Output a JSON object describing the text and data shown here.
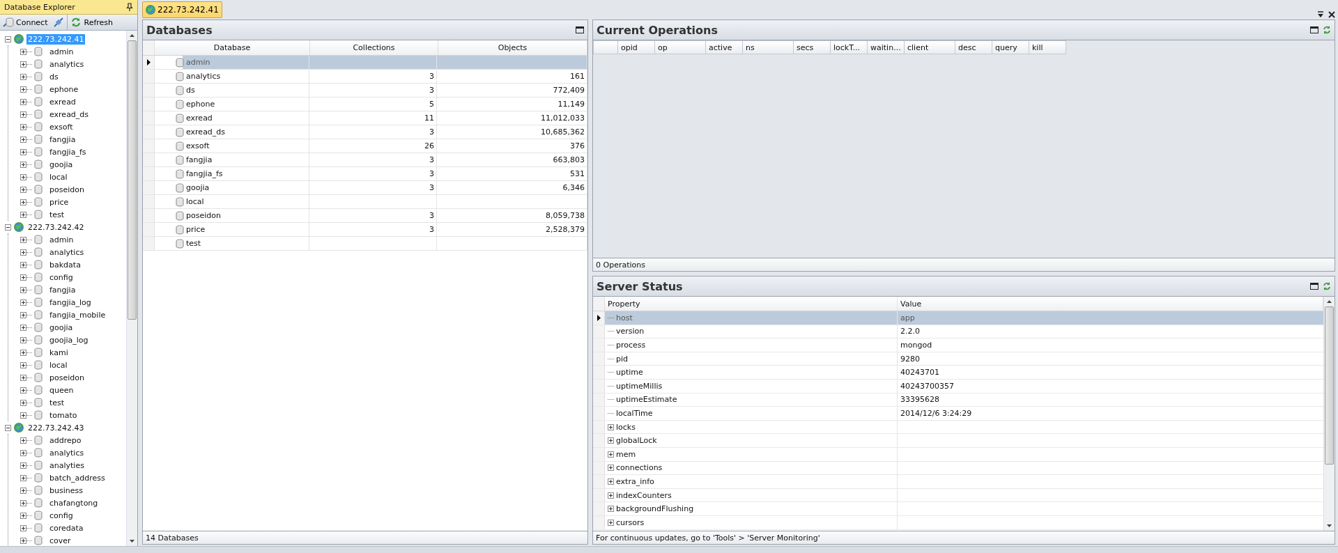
{
  "sidebar": {
    "title": "Database Explorer",
    "toolbar": [
      {
        "kind": "connect",
        "label": "Connect"
      },
      {
        "kind": "disconnect"
      },
      {
        "kind": "refresh",
        "label": "Refresh"
      }
    ],
    "tree": [
      {
        "label": "222.73.242.41",
        "selected": true,
        "expanded": true,
        "children": [
          {
            "label": "admin",
            "expanded": false
          },
          {
            "label": "analytics",
            "expanded": false
          },
          {
            "label": "ds",
            "expanded": false
          },
          {
            "label": "ephone",
            "expanded": false
          },
          {
            "label": "exread",
            "expanded": false
          },
          {
            "label": "exread_ds",
            "expanded": false
          },
          {
            "label": "exsoft",
            "expanded": false
          },
          {
            "label": "fangjia",
            "expanded": false
          },
          {
            "label": "fangjia_fs",
            "expanded": false
          },
          {
            "label": "goojia",
            "expanded": false
          },
          {
            "label": "local",
            "expanded": false
          },
          {
            "label": "poseidon",
            "expanded": false
          },
          {
            "label": "price",
            "expanded": false
          },
          {
            "label": "test",
            "expanded": false
          }
        ]
      },
      {
        "label": "222.73.242.42",
        "selected": false,
        "expanded": true,
        "children": [
          {
            "label": "admin",
            "expanded": false
          },
          {
            "label": "analytics",
            "expanded": false
          },
          {
            "label": "bakdata",
            "expanded": false
          },
          {
            "label": "config",
            "expanded": false
          },
          {
            "label": "fangjia",
            "expanded": false
          },
          {
            "label": "fangjia_log",
            "expanded": false
          },
          {
            "label": "fangjia_mobile",
            "expanded": false
          },
          {
            "label": "goojia",
            "expanded": false
          },
          {
            "label": "goojia_log",
            "expanded": false
          },
          {
            "label": "kami",
            "expanded": false
          },
          {
            "label": "local",
            "expanded": false
          },
          {
            "label": "poseidon",
            "expanded": false
          },
          {
            "label": "queen",
            "expanded": false
          },
          {
            "label": "test",
            "expanded": false
          },
          {
            "label": "tomato",
            "expanded": false
          }
        ]
      },
      {
        "label": "222.73.242.43",
        "selected": false,
        "expanded": true,
        "children": [
          {
            "label": "addrepo",
            "expanded": false
          },
          {
            "label": "analytics",
            "expanded": false
          },
          {
            "label": "analyties",
            "expanded": false
          },
          {
            "label": "batch_address",
            "expanded": false
          },
          {
            "label": "business",
            "expanded": false
          },
          {
            "label": "chafangtong",
            "expanded": false
          },
          {
            "label": "config",
            "expanded": false
          },
          {
            "label": "coredata",
            "expanded": false
          },
          {
            "label": "cover",
            "expanded": false
          }
        ]
      }
    ]
  },
  "tabs": [
    {
      "label": "222.73.242.41",
      "selected": true
    }
  ],
  "databases": {
    "title": "Databases",
    "columns": [
      "Database",
      "Collections",
      "Objects"
    ],
    "rows": [
      {
        "database": "admin",
        "collections": "",
        "objects": "",
        "selected": true
      },
      {
        "database": "analytics",
        "collections": "3",
        "objects": "161",
        "selected": false
      },
      {
        "database": "ds",
        "collections": "3",
        "objects": "772,409",
        "selected": false
      },
      {
        "database": "ephone",
        "collections": "5",
        "objects": "11,149",
        "selected": false
      },
      {
        "database": "exread",
        "collections": "11",
        "objects": "11,012,033",
        "selected": false
      },
      {
        "database": "exread_ds",
        "collections": "3",
        "objects": "10,685,362",
        "selected": false
      },
      {
        "database": "exsoft",
        "collections": "26",
        "objects": "376",
        "selected": false
      },
      {
        "database": "fangjia",
        "collections": "3",
        "objects": "663,803",
        "selected": false
      },
      {
        "database": "fangjia_fs",
        "collections": "3",
        "objects": "531",
        "selected": false
      },
      {
        "database": "goojia",
        "collections": "3",
        "objects": "6,346",
        "selected": false
      },
      {
        "database": "local",
        "collections": "",
        "objects": "",
        "selected": false
      },
      {
        "database": "poseidon",
        "collections": "3",
        "objects": "8,059,738",
        "selected": false
      },
      {
        "database": "price",
        "collections": "3",
        "objects": "2,528,379",
        "selected": false
      },
      {
        "database": "test",
        "collections": "",
        "objects": "",
        "selected": false
      }
    ],
    "footer": "14 Databases"
  },
  "current_operations": {
    "title": "Current Operations",
    "columns": [
      "opid",
      "op",
      "active",
      "ns",
      "secs",
      "lockT...",
      "waitin...",
      "client",
      "desc",
      "query",
      "kill"
    ],
    "footer": "0 Operations"
  },
  "server_status": {
    "title": "Server Status",
    "columns": [
      "Property",
      "Value"
    ],
    "rows": [
      {
        "kind": "leaf",
        "property": "host",
        "value": "app",
        "selected": true
      },
      {
        "kind": "leaf",
        "property": "version",
        "value": "2.2.0",
        "selected": false
      },
      {
        "kind": "leaf",
        "property": "process",
        "value": "mongod",
        "selected": false
      },
      {
        "kind": "leaf",
        "property": "pid",
        "value": "9280",
        "selected": false
      },
      {
        "kind": "leaf",
        "property": "uptime",
        "value": "40243701",
        "selected": false
      },
      {
        "kind": "leaf",
        "property": "uptimeMillis",
        "value": "40243700357",
        "selected": false
      },
      {
        "kind": "leaf",
        "property": "uptimeEstimate",
        "value": "33395628",
        "selected": false
      },
      {
        "kind": "leaf",
        "property": "localTime",
        "value": "2014/12/6 3:24:29",
        "selected": false
      },
      {
        "kind": "group",
        "property": "locks",
        "value": "",
        "selected": false
      },
      {
        "kind": "group",
        "property": "globalLock",
        "value": "",
        "selected": false
      },
      {
        "kind": "group",
        "property": "mem",
        "value": "",
        "selected": false
      },
      {
        "kind": "group",
        "property": "connections",
        "value": "",
        "selected": false
      },
      {
        "kind": "group",
        "property": "extra_info",
        "value": "",
        "selected": false
      },
      {
        "kind": "group",
        "property": "indexCounters",
        "value": "",
        "selected": false
      },
      {
        "kind": "group",
        "property": "backgroundFlushing",
        "value": "",
        "selected": false
      },
      {
        "kind": "group",
        "property": "cursors",
        "value": "",
        "selected": false
      }
    ],
    "footer": "For continuous updates, go to 'Tools' > 'Server Monitoring'"
  }
}
